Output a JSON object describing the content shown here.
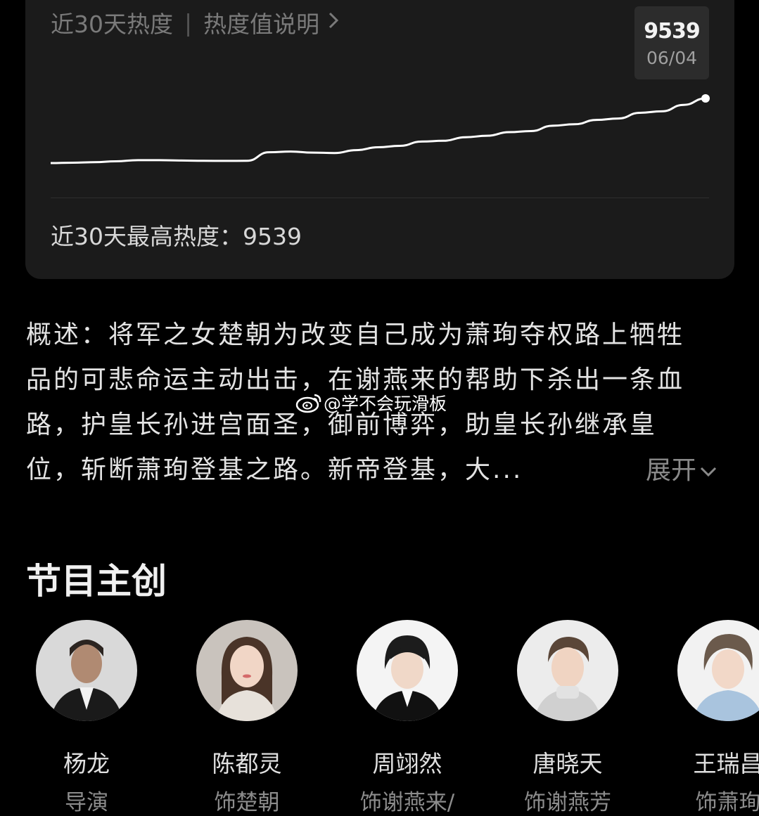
{
  "heat_card": {
    "header_title": "近30天热度",
    "header_separator": "|",
    "header_link": "热度值说明",
    "tooltip_value": "9539",
    "tooltip_date": "06/04",
    "max_label": "近30天最高热度：9539"
  },
  "chart_data": {
    "type": "line",
    "series": [
      {
        "values": [
          6900,
          6905,
          6912,
          6925,
          6940,
          6940,
          6935,
          6932,
          6930,
          6932,
          7050,
          7060,
          7045,
          7040,
          7080,
          7120,
          7140,
          7200,
          7210,
          7260,
          7280,
          7330,
          7345,
          7420,
          7440,
          7500,
          7520,
          7600,
          7620,
          7710,
          7800
        ]
      }
    ],
    "highlight_value": 9539,
    "highlight_date": "06/04",
    "color": "#ffffff",
    "grid": false
  },
  "summary": {
    "lines": [
      "概述：将军之女楚朝为改变自己成为萧珣夺权路上牺牲",
      "品的可悲命运主动出击，在谢燕来的帮助下杀出一条血",
      "路，护皇长孙进宫面圣，御前博弈，助皇长孙继承皇",
      "位，斩断萧珣登基之路。新帝登基，大..."
    ],
    "expand_label": "展开"
  },
  "watermark": {
    "text": "@学不会玩滑板",
    "icon": "weibo-icon"
  },
  "crew": {
    "title": "节目主创",
    "members": [
      {
        "name": "杨龙",
        "role": "导演"
      },
      {
        "name": "陈都灵",
        "role": "饰楚朝"
      },
      {
        "name": "周翊然",
        "role": "饰谢燕来/"
      },
      {
        "name": "唐晓天",
        "role": "饰谢燕芳"
      },
      {
        "name": "王瑞昌",
        "role": "饰萧珣"
      }
    ]
  }
}
